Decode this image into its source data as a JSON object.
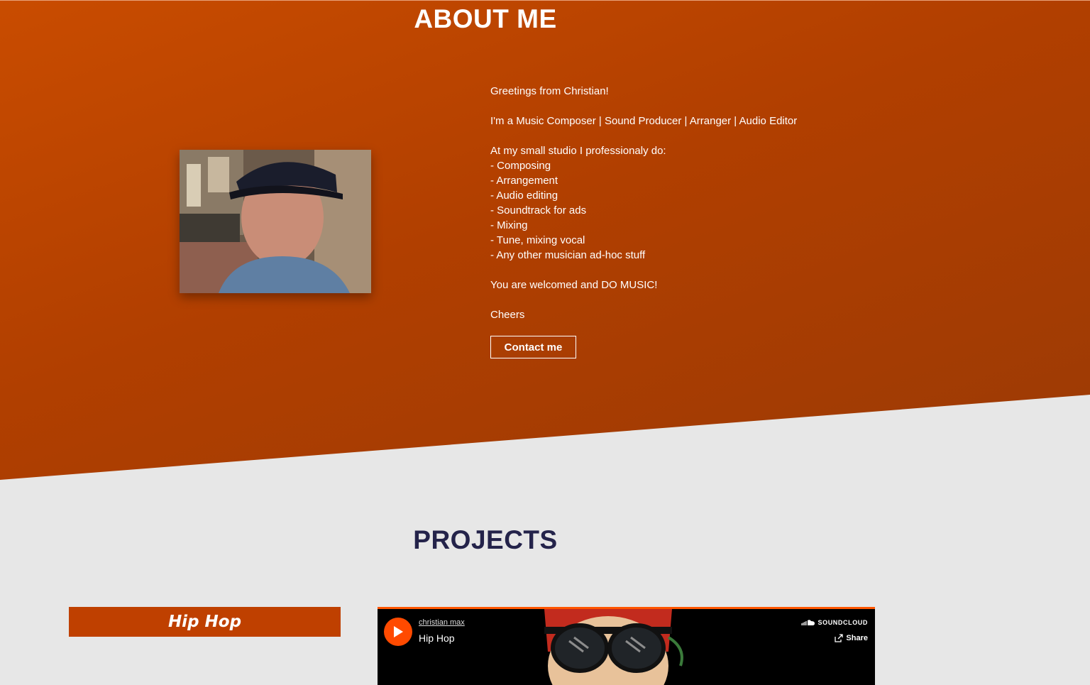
{
  "about": {
    "title": "ABOUT ME",
    "lines": [
      "Greetings from Christian!",
      "",
      "I'm a Music Composer | Sound Producer | Arranger | Audio Editor",
      "",
      "At my small studio I professionaly do:",
      "- Composing",
      "- Arrangement",
      "- Audio editing",
      "- Soundtrack for ads",
      "- Mixing",
      "- Tune, mixing vocal",
      "- Any other musician ad-hoc stuff",
      "",
      "You are welcomed and DO MUSIC!",
      "",
      "Cheers"
    ],
    "contact_label": "Contact me"
  },
  "projects": {
    "title": "PROJECTS",
    "genre_label": "Hip Hop",
    "player": {
      "artist": "christian max",
      "track": "Hip Hop",
      "brand": "SOUNDCLOUD",
      "share_label": "Share"
    }
  },
  "colors": {
    "about_bg": "#b84200",
    "page_bg": "#e7e7e7",
    "accent": "#bf4000",
    "projects_title": "#24234a",
    "soundcloud": "#ff5500"
  },
  "icons": [
    "play-icon",
    "soundcloud-icon",
    "share-icon"
  ]
}
